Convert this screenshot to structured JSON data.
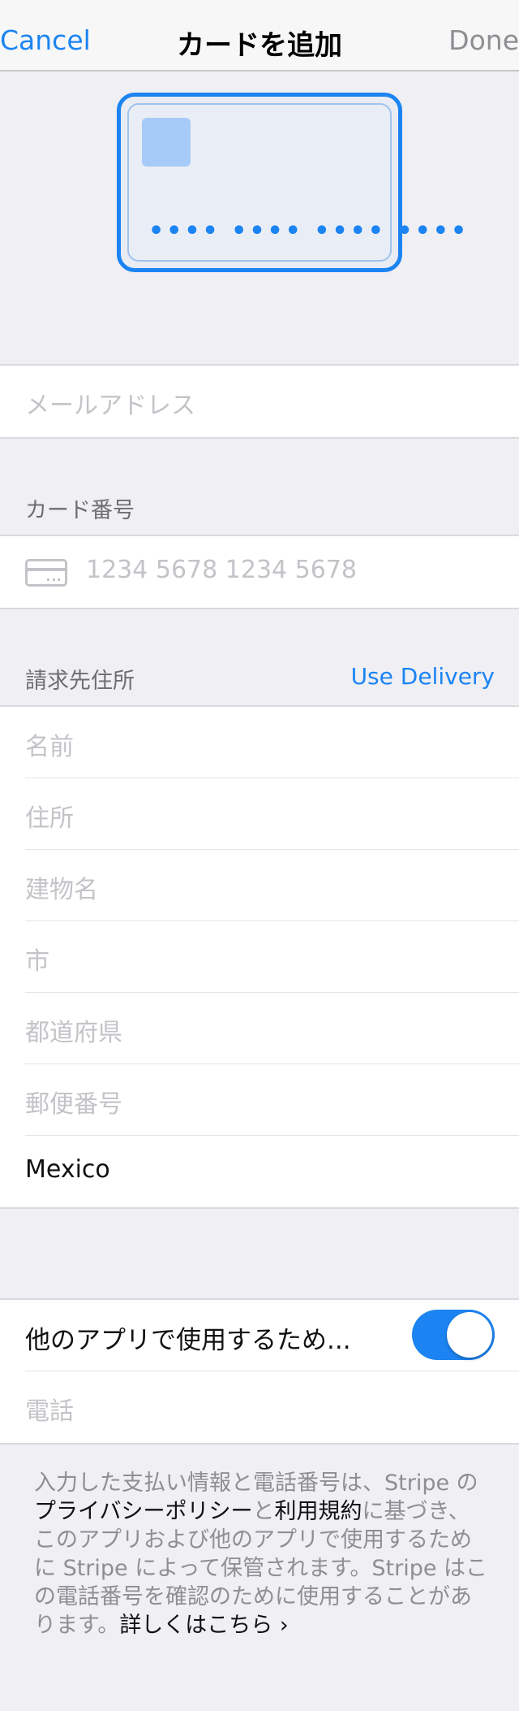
{
  "nav": {
    "cancel_label": "Cancel",
    "title": "カードを追加",
    "done_label": "Done"
  },
  "card_preview": {
    "number_mask": "•••• •••• •••• ••••"
  },
  "email": {
    "placeholder": "メールアドレス"
  },
  "card_number": {
    "header": "カード番号",
    "icon": "credit-card-icon",
    "placeholder": "1234 5678 1234 5678"
  },
  "billing": {
    "header": "請求先住所",
    "use_delivery_label": "Use Delivery",
    "fields": {
      "name": "名前",
      "address": "住所",
      "building": "建物名",
      "city": "市",
      "prefecture": "都道府県",
      "postal_code": "郵便番号",
      "country": "Mexico"
    }
  },
  "save": {
    "toggle_label": "他のアプリで使用するため...",
    "toggle_on": true,
    "phone_placeholder": "電話"
  },
  "footer": {
    "text_1": "入力した支払い情報と電話番号は、Stripe の",
    "privacy_link": "プライバシーポリシー",
    "text_2": "と",
    "terms_link": "利用規約",
    "text_3": "に基づき、このアプリおよび他のアプリで使用するために Stripe によって保管されます。Stripe はこの電話番号を確認のために使用することがあります。",
    "details_link": "詳しくはこちら ›"
  },
  "colors": {
    "accent": "#1c84f2",
    "background": "#efeff4",
    "placeholder": "#c3c3c8"
  }
}
